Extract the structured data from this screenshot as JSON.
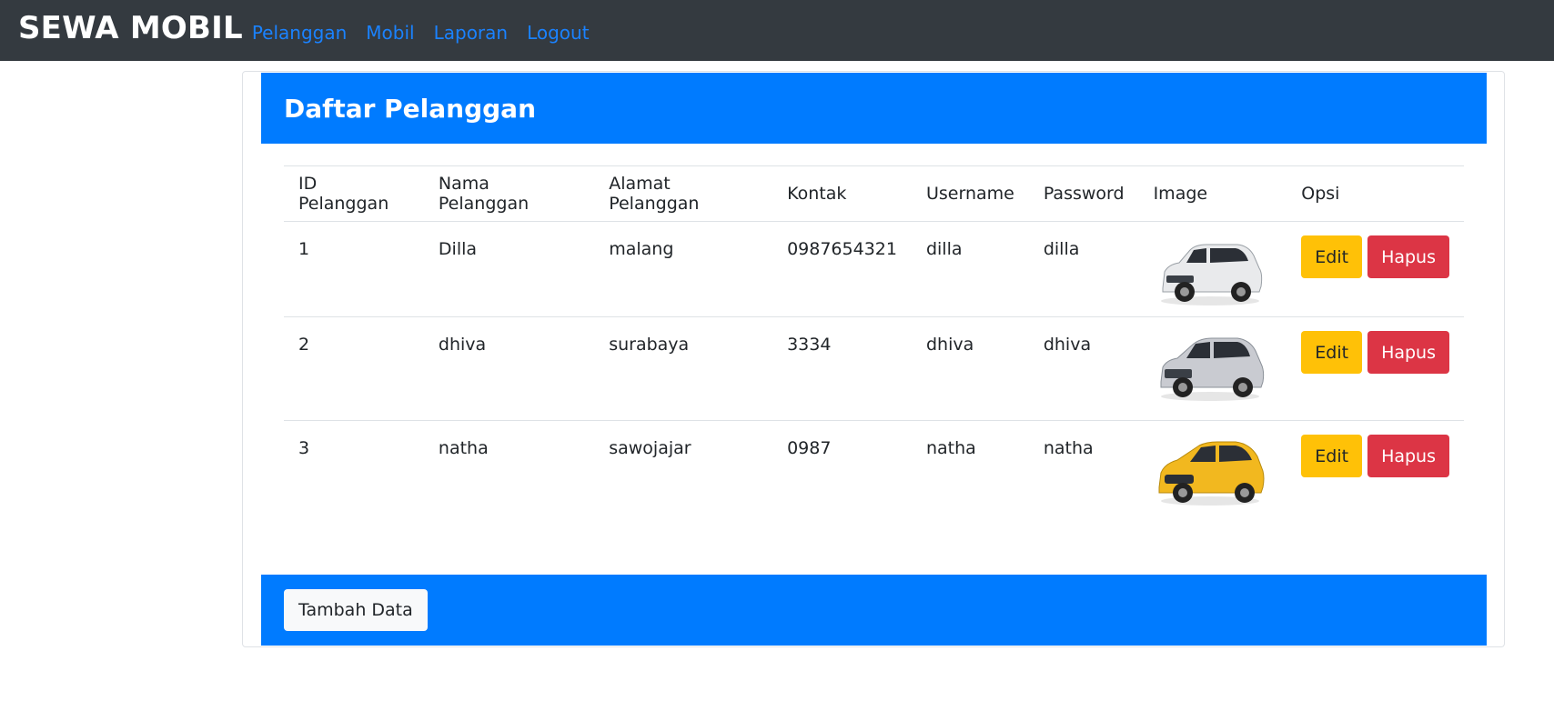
{
  "navbar": {
    "brand": "SEWA MOBIL",
    "links": [
      "Pelanggan",
      "Mobil",
      "Laporan",
      "Logout"
    ]
  },
  "card": {
    "title": "Daftar Pelanggan",
    "add_button": "Tambah Data"
  },
  "table": {
    "headers": [
      "ID Pelanggan",
      "Nama Pelanggan",
      "Alamat Pelanggan",
      "Kontak",
      "Username",
      "Password",
      "Image",
      "Opsi"
    ],
    "rows": [
      {
        "id": "1",
        "nama": "Dilla",
        "alamat": "malang",
        "kontak": "0987654321",
        "username": "dilla",
        "password": "dilla",
        "car_color": "#e9eaec"
      },
      {
        "id": "2",
        "nama": "dhiva",
        "alamat": "surabaya",
        "kontak": "3334",
        "username": "dhiva",
        "password": "dhiva",
        "car_color": "#c9cbd1"
      },
      {
        "id": "3",
        "nama": "natha",
        "alamat": "sawojajar",
        "kontak": "0987",
        "username": "natha",
        "password": "natha",
        "car_color": "#f2b81f"
      }
    ],
    "edit_label": "Edit",
    "delete_label": "Hapus"
  },
  "colors": {
    "navbar": "#343a40",
    "primary": "#007bff",
    "link": "#1a82ff",
    "warning": "#ffc107",
    "danger": "#dc3545"
  }
}
